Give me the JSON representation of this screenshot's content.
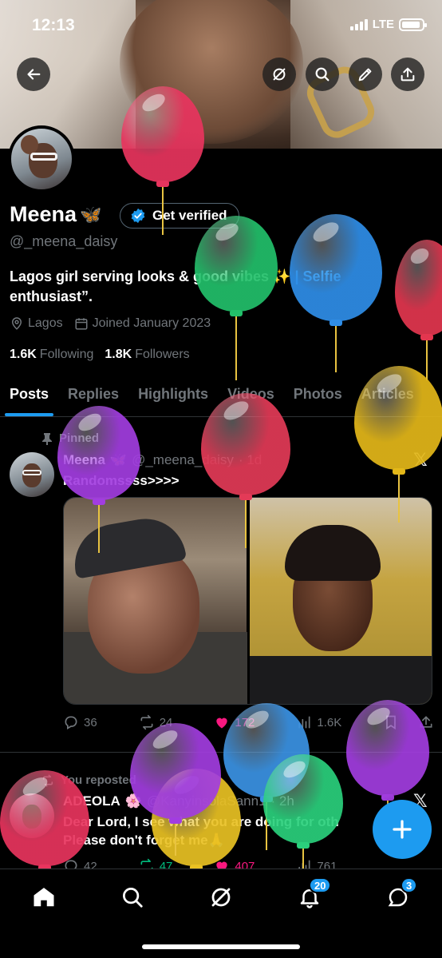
{
  "status_bar": {
    "time": "12:13",
    "network": "LTE",
    "battery_level": 0.9
  },
  "top_actions": [
    "back-arrow-icon",
    "grok-icon",
    "search-icon",
    "edit-icon",
    "share-icon"
  ],
  "profile": {
    "name": "Meena",
    "name_emoji": "🦋",
    "verify_label": "Get verified",
    "handle": "@_meena_daisy",
    "bio_text": "Lagos girl serving looks & good vibes ✨",
    "bio_link": " | Selfie",
    "bio_line2": "enthusiast”.",
    "location": "Lagos",
    "joined": "Joined January 2023",
    "following_count": "1.6K",
    "following_label": "Following",
    "followers_count": "1.8K",
    "followers_label": "Followers"
  },
  "tabs": [
    {
      "label": "Posts",
      "active": true
    },
    {
      "label": "Replies"
    },
    {
      "label": "Highlights"
    },
    {
      "label": "Videos"
    },
    {
      "label": "Photos"
    },
    {
      "label": "Articles"
    }
  ],
  "posts": [
    {
      "context": "Pinned",
      "name": "Meena",
      "name_emoji": "🦋",
      "handle": "@_meena_daisy",
      "time": "· 1d",
      "text": "Randomssss>>>>",
      "replies": "36",
      "reposts": "24",
      "likes": "172",
      "views": "1.6K"
    },
    {
      "context": "You reposted",
      "name": "ADEOLA",
      "name_emoji": "🌸",
      "handle": "@KanyinsolaSann1",
      "time": "· 2h",
      "text_line1": "Dear Lord, I see what you are doing for oth",
      "text_line2": "Please don't forget me🙏",
      "replies": "42",
      "reposts": "47",
      "likes": "407",
      "views": "761"
    }
  ],
  "bottom_nav": {
    "items": [
      "home-icon",
      "search-icon",
      "grok-icon",
      "notifications-icon",
      "messages-icon"
    ],
    "notifications_badge": "20",
    "messages_badge": "3"
  },
  "colors": {
    "accent": "#1d9bf0",
    "like": "#f91880",
    "repost": "#00ba7c",
    "balloons": [
      "#e8345e",
      "#22c06a",
      "#2f8ee8",
      "#e3364f",
      "#a23de0",
      "#e33a57",
      "#e4b819",
      "#3b93e4",
      "#a23de0",
      "#e9c123",
      "#2ad07c",
      "#a23de0",
      "#e8345e"
    ]
  }
}
